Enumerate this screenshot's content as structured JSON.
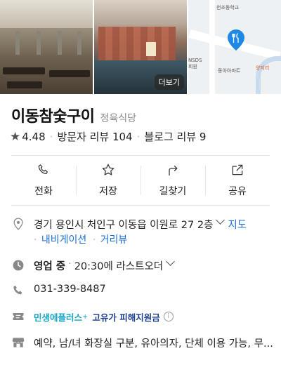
{
  "photos": {
    "more_label": "더보기",
    "map": {
      "labels": [
        "천조동학교",
        "NSDS 회원",
        "동아아파트",
        "양지리"
      ]
    }
  },
  "place": {
    "name": "이동참숯구이",
    "category": "정육식당",
    "rating": "4.48",
    "visitor_reviews": "방문자 리뷰 104",
    "blog_reviews": "블로그 리뷰 9"
  },
  "actions": [
    {
      "label": "전화",
      "icon": "phone-icon"
    },
    {
      "label": "저장",
      "icon": "star-icon"
    },
    {
      "label": "길찾기",
      "icon": "directions-icon"
    },
    {
      "label": "공유",
      "icon": "share-icon"
    }
  ],
  "info": {
    "address": "경기 용인시 처인구 이동읍 이원로 27 2층",
    "map_link": "지도",
    "navigation_link": "내비게이션",
    "distance_link": "거리뷰",
    "status": "영업 중",
    "hours": "20:30에 라스트오더",
    "phone": "031-339-8487",
    "minsaeng": "민생에플러스",
    "minsaeng_plus": "+",
    "gyuga": "고유가 피해지원금",
    "info_mark": "i",
    "amenities": "예약, 남/녀 화장실 구분, 유아의자, 단체 이용 가능, 무..."
  },
  "colors": {
    "link": "#1d6fd8",
    "minsaeng": "#1aa5c4",
    "gyuga": "#1d3f8c",
    "pin": "#1e88e5"
  }
}
